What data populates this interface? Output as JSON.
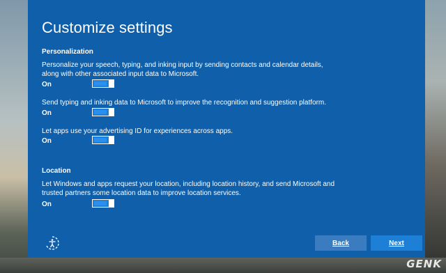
{
  "title": "Customize settings",
  "personalization": {
    "heading": "Personalization",
    "items": [
      {
        "desc": "Personalize your speech, typing, and inking input by sending contacts and calendar details, along with other associated input data to Microsoft.",
        "state": "On"
      },
      {
        "desc": "Send typing and inking data to Microsoft to improve the recognition and suggestion platform.",
        "state": "On"
      },
      {
        "desc": "Let apps use your advertising ID for experiences across apps.",
        "state": "On"
      }
    ]
  },
  "location": {
    "heading": "Location",
    "items": [
      {
        "desc": "Let Windows and apps request your location, including location history, and send Microsoft and trusted partners some location data to improve location services.",
        "state": "On"
      }
    ]
  },
  "buttons": {
    "back": "Back",
    "next": "Next"
  },
  "watermark": "GENK",
  "colors": {
    "panel": "#0f5fab",
    "toggle_on": "#1e7fd6",
    "back_button": "#3b7bbf",
    "next_button": "#1e7fd6"
  },
  "icons": {
    "accessibility": "ease-of-access-icon"
  }
}
